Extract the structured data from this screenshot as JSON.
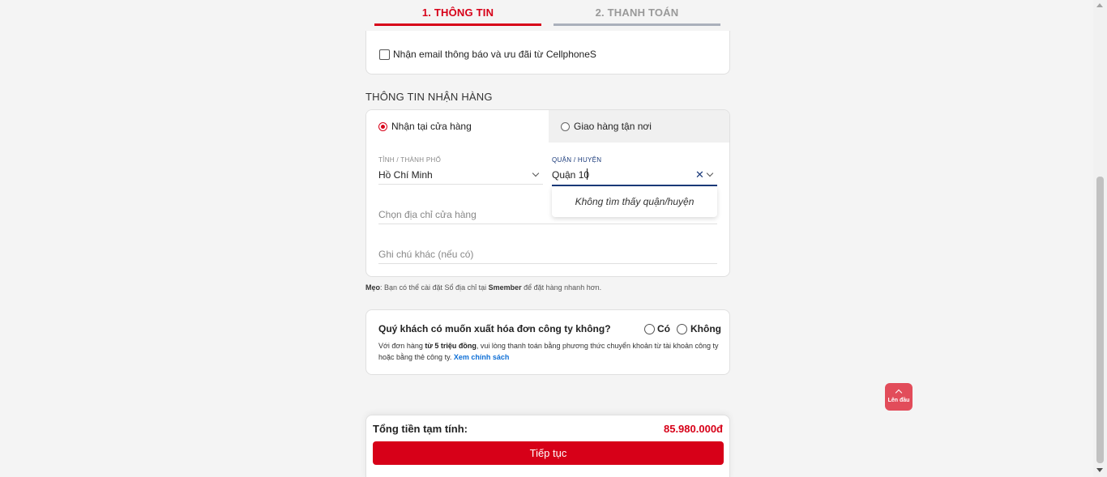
{
  "steps": {
    "step1": "1. THÔNG TIN",
    "step2": "2. THANH TOÁN"
  },
  "newsletter": {
    "label": "Nhận email thông báo và ưu đãi từ CellphoneS",
    "checked": false
  },
  "shipping": {
    "section_title": "THÔNG TIN NHẬN HÀNG",
    "tabs": [
      {
        "label": "Nhận tại cửa hàng",
        "selected": true
      },
      {
        "label": "Giao hàng tận nơi",
        "selected": false
      }
    ],
    "province": {
      "label": "TỈNH / THÀNH PHỐ",
      "value": "Hồ Chí Minh"
    },
    "district": {
      "label": "QUẬN / HUYỆN",
      "value": "Quận 10"
    },
    "district_dropdown_message": "Không tìm thấy quận/huyện",
    "store_placeholder": "Chọn địa chỉ cửa hàng",
    "note_placeholder": "Ghi chú khác (nếu có)"
  },
  "tip": {
    "prefix": "Mẹo",
    "text_before": ": Bạn có thể cài đặt Sổ địa chỉ tại ",
    "smember": "Smember",
    "text_after": " để đặt hàng nhanh hơn."
  },
  "invoice": {
    "question": "Quý khách có muốn xuất hóa đơn công ty không?",
    "option_yes": "Có",
    "option_no": "Không",
    "note_before": "Với đơn hàng ",
    "note_bold": "từ 5 triệu đồng",
    "note_after": ", vui lòng thanh toán bằng phương thức chuyển khoản từ tài khoản công ty hoặc bằng thẻ công ty. ",
    "policy_link": "Xem chính sách"
  },
  "back_to_top": "Lên đầu",
  "summary": {
    "total_label": "Tổng tiền tạm tính:",
    "total_value": "85.980.000đ",
    "continue_label": "Tiếp tục"
  },
  "colors": {
    "brand_red": "#d70018",
    "link_blue": "#0e6fd6",
    "back_to_top": "#e24c5a"
  }
}
